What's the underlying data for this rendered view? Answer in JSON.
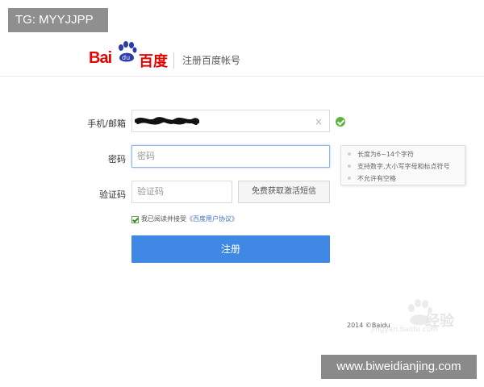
{
  "overlay": {
    "tag": "TG: MYYJJPP",
    "site": "www.biweidianjing.com"
  },
  "header": {
    "logo_bai": "Bai",
    "logo_du": "du",
    "logo_cn": "百度",
    "title": "注册百度帐号"
  },
  "form": {
    "phone": {
      "label": "手机/邮箱",
      "clear": "×"
    },
    "password": {
      "label": "密码",
      "placeholder": "密码",
      "tips": [
        "长度为6~14个字符",
        "支持数字,大小写字母和标点符号",
        "不允许有空格"
      ]
    },
    "code": {
      "label": "验证码",
      "placeholder": "验证码",
      "sms_button": "免费获取激活短信"
    },
    "agree": {
      "text": "我已阅读并接受",
      "link": "《百度用户协议》"
    },
    "submit": "注册"
  },
  "footer": {
    "copyright": "2014 ©Baidu",
    "watermark": "经验",
    "watermark_url": "jingyan.baidu.com"
  },
  "colors": {
    "brand": "#e10601",
    "primary": "#3f89e4",
    "success": "#5cb53a"
  }
}
